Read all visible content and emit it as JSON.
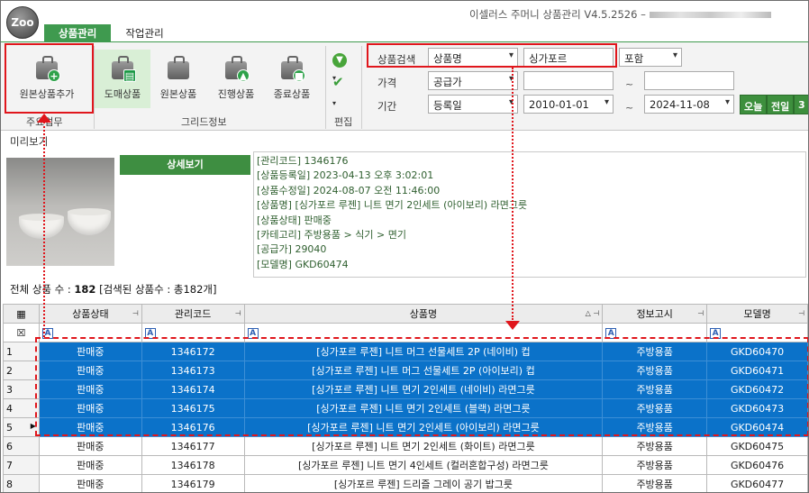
{
  "app": {
    "logo": "Zoo",
    "title": "이셀러스 주머니 상품관리 V4.5.2526 –"
  },
  "tabs": [
    {
      "label": "상품관리",
      "active": true
    },
    {
      "label": "작업관리",
      "active": false
    }
  ],
  "ribbon": {
    "buttons": [
      {
        "label": "원본상품추가",
        "icon": "bag-add-icon"
      },
      {
        "label": "도매상품",
        "icon": "bag-wholesale-icon"
      },
      {
        "label": "원본상품",
        "icon": "bag-original-icon"
      },
      {
        "label": "진행상품",
        "icon": "bag-progress-icon"
      },
      {
        "label": "종료상품",
        "icon": "bag-ended-icon"
      }
    ],
    "groups": {
      "main": "주요업무",
      "grid": "그리드정보",
      "edit": "편집"
    }
  },
  "search": {
    "search_label": "상품검색",
    "search_field": "상품명",
    "search_value": "싱가포르",
    "match": "포함",
    "price_label": "가격",
    "price_field": "공급가",
    "price_from": "",
    "price_to": "",
    "period_label": "기간",
    "period_field": "등록일",
    "date_from": "2010-01-01",
    "date_to": "2024-11-08",
    "tilde": "~",
    "quick": [
      "오늘",
      "전일",
      "3"
    ]
  },
  "preview": {
    "label": "미리보기",
    "detail_button": "상세보기",
    "info_lines": [
      "[관리코드] 1346176",
      "[상품등록일] 2023-04-13 오후 3:02:01",
      "[상품수정일] 2024-08-07 오전 11:46:00",
      "[상품명] [싱가포르 루젠] 니트 면기 2인세트 (아이보리) 라면그릇",
      "[상품상태] 판매중",
      "[카테고리] 주방용품 > 식기 > 면기",
      "[공급가] 29040",
      "[모델명] GKD60474"
    ]
  },
  "summary": {
    "prefix": "전체 상품 수 :",
    "total": "182",
    "found": "[검색된 상품수 : 총182개]"
  },
  "grid": {
    "columns": [
      "상품상태",
      "관리코드",
      "상품명",
      "정보고시",
      "모델명"
    ],
    "sort_indicator": "△",
    "rows": [
      {
        "num": "1",
        "status": "판매중",
        "code": "1346172",
        "name": "[싱가포르 루젠] 니트 머그 선물세트 2P (네이비) 컵",
        "notice": "주방용품",
        "model": "GKD60470",
        "selected": true
      },
      {
        "num": "2",
        "status": "판매중",
        "code": "1346173",
        "name": "[싱가포르 루젠] 니트 머그 선물세트 2P (아이보리) 컵",
        "notice": "주방용품",
        "model": "GKD60471",
        "selected": true
      },
      {
        "num": "3",
        "status": "판매중",
        "code": "1346174",
        "name": "[싱가포르 루젠] 니트 면기 2인세트 (네이비) 라면그릇",
        "notice": "주방용품",
        "model": "GKD60472",
        "selected": true
      },
      {
        "num": "4",
        "status": "판매중",
        "code": "1346175",
        "name": "[싱가포르 루젠] 니트 면기 2인세트 (블랙) 라면그릇",
        "notice": "주방용품",
        "model": "GKD60473",
        "selected": true
      },
      {
        "num": "5",
        "status": "판매중",
        "code": "1346176",
        "name": "[싱가포르 루젠] 니트 면기 2인세트 (아이보리) 라면그릇",
        "notice": "주방용품",
        "model": "GKD60474",
        "selected": true,
        "current": true
      },
      {
        "num": "6",
        "status": "판매중",
        "code": "1346177",
        "name": "[싱가포르 루젠] 니트 면기 2인세트 (화이트) 라면그릇",
        "notice": "주방용품",
        "model": "GKD60475",
        "selected": false
      },
      {
        "num": "7",
        "status": "판매중",
        "code": "1346178",
        "name": "[싱가포르 루젠] 니트 면기 4인세트 (컬러혼합구성) 라면그릇",
        "notice": "주방용품",
        "model": "GKD60476",
        "selected": false
      },
      {
        "num": "8",
        "status": "판매중",
        "code": "1346179",
        "name": "[싱가포르 루젠] 드리즐 그레이 공기 밥그릇",
        "notice": "주방용품",
        "model": "GKD60477",
        "selected": false
      }
    ]
  },
  "colors": {
    "accent_green": "#3f9a4f",
    "selection_blue": "#0b72c9",
    "highlight_red": "#e0161c"
  }
}
